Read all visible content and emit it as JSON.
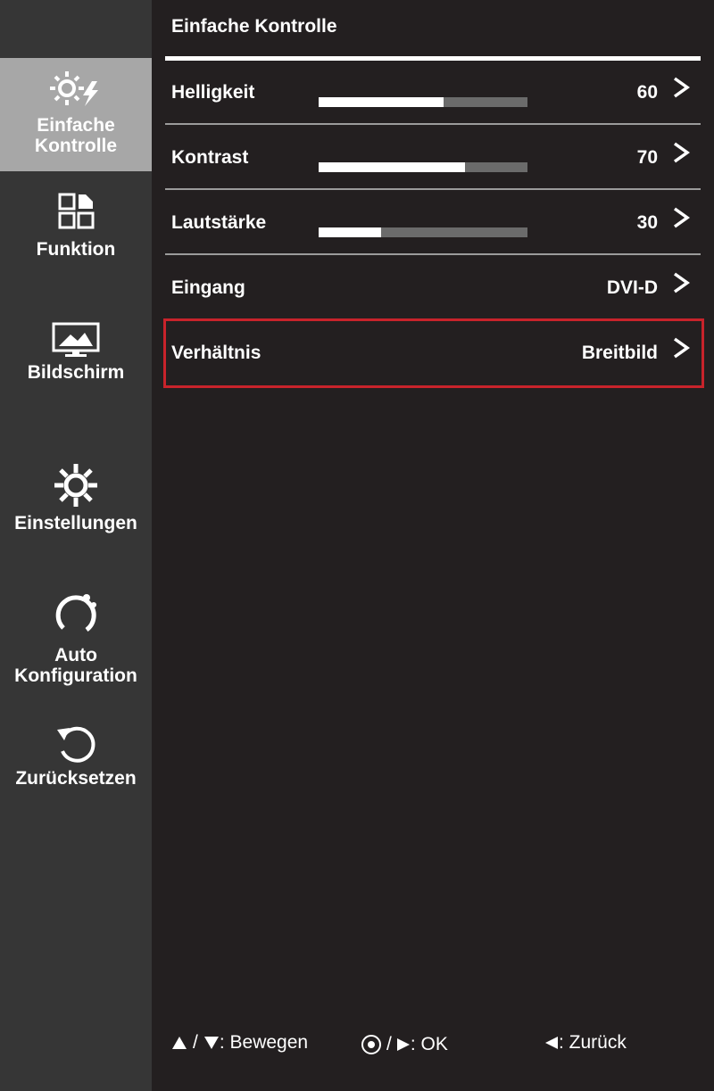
{
  "sidebar": {
    "items": [
      {
        "label": "Einfache\nKontrolle",
        "icon": "brightness-bolt-icon",
        "active": true
      },
      {
        "label": "Funktion",
        "icon": "grid-icon",
        "active": false
      },
      {
        "label": "Bildschirm",
        "icon": "monitor-icon",
        "active": false
      },
      {
        "label": "Einstellungen",
        "icon": "gear-icon",
        "active": false
      },
      {
        "label": "Auto\nKonfiguration",
        "icon": "auto-config-icon",
        "active": false
      },
      {
        "label": "Zurücksetzen",
        "icon": "reset-icon",
        "active": false
      }
    ]
  },
  "panel": {
    "title": "Einfache Kontrolle",
    "rows": [
      {
        "label": "Helligkeit",
        "value": "60",
        "level": 60
      },
      {
        "label": "Kontrast",
        "value": "70",
        "level": 70
      },
      {
        "label": "Lautstärke",
        "value": "30",
        "level": 30
      },
      {
        "label": "Eingang",
        "value": "DVI-D"
      },
      {
        "label": "Verhältnis",
        "value": "Breitbild",
        "selected": true
      }
    ]
  },
  "footer": {
    "move_label": ": Bewegen",
    "ok_label": ": OK",
    "back_label": ": Zurück"
  },
  "colors": {
    "background": "#231f20",
    "sidebar": "#363636",
    "active_tab": "#a7a7a7",
    "selection": "#c8232b",
    "slider_track": "#6b6b6b",
    "slider_fill": "#ffffff"
  }
}
